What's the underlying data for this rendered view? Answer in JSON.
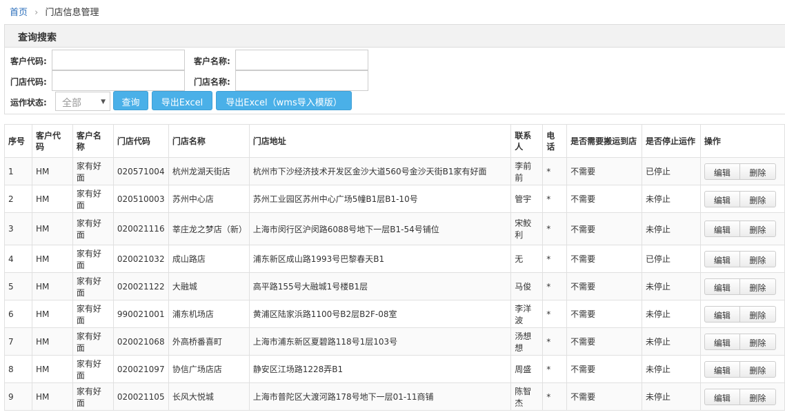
{
  "breadcrumb": {
    "home": "首页",
    "separator": "›",
    "current": "门店信息管理"
  },
  "search": {
    "title": "查询搜索",
    "customer_code_label": "客户代码:",
    "customer_name_label": "客户名称:",
    "store_code_label": "门店代码:",
    "store_name_label": "门店名称:",
    "status_label": "运作状态:",
    "status_value": "全部",
    "query_btn": "查询",
    "export_btn": "导出Excel",
    "export_wms_btn": "导出Excel（wms导入模版）"
  },
  "table": {
    "headers": [
      "序号",
      "客户代码",
      "客户名称",
      "门店代码",
      "门店名称",
      "门店地址",
      "联系人",
      "电话",
      "是否需要搬运到店",
      "是否停止运作",
      "操作"
    ],
    "edit_label": "编辑",
    "delete_label": "删除",
    "rows": [
      [
        "1",
        "HM",
        "家有好面",
        "020571004",
        "杭州龙湖天街店",
        "杭州市下沙经济技术开发区金沙大道560号金沙天街B1家有好面",
        "李前前",
        "*",
        "不需要",
        "已停止"
      ],
      [
        "2",
        "HM",
        "家有好面",
        "020510003",
        "苏州中心店",
        "苏州工业园区苏州中心广场5幢B1层B1-10号",
        "管宇",
        "*",
        "不需要",
        "未停止"
      ],
      [
        "3",
        "HM",
        "家有好面",
        "020021116",
        "莘庄龙之梦店（新）",
        "上海市闵行区沪闵路6088号地下一层B1-54号铺位",
        "宋鲛利",
        "*",
        "不需要",
        "未停止"
      ],
      [
        "4",
        "HM",
        "家有好面",
        "020021032",
        "成山路店",
        "浦东新区成山路1993号巴黎春天B1",
        "无",
        "*",
        "不需要",
        "已停止"
      ],
      [
        "5",
        "HM",
        "家有好面",
        "020021122",
        "大融城",
        "高平路155号大融城1号楼B1层",
        "马俊",
        "*",
        "不需要",
        "未停止"
      ],
      [
        "6",
        "HM",
        "家有好面",
        "990021001",
        "浦东机场店",
        "黄浦区陆家浜路1100号B2层B2F-08室",
        "李洋波",
        "*",
        "不需要",
        "未停止"
      ],
      [
        "7",
        "HM",
        "家有好面",
        "020021068",
        "外高桥番喜町",
        "上海市浦东新区夏碧路118号1层103号",
        "汤想想",
        "*",
        "不需要",
        "未停止"
      ],
      [
        "8",
        "HM",
        "家有好面",
        "020021097",
        "协信广场店店",
        "静安区江场路1228弄B1",
        "周盛",
        "*",
        "不需要",
        "未停止"
      ],
      [
        "9",
        "HM",
        "家有好面",
        "020021105",
        "长风大悦城",
        "上海市普陀区大渡河路178号地下一层01-11商铺",
        "陈智杰",
        "*",
        "不需要",
        "未停止"
      ]
    ]
  }
}
